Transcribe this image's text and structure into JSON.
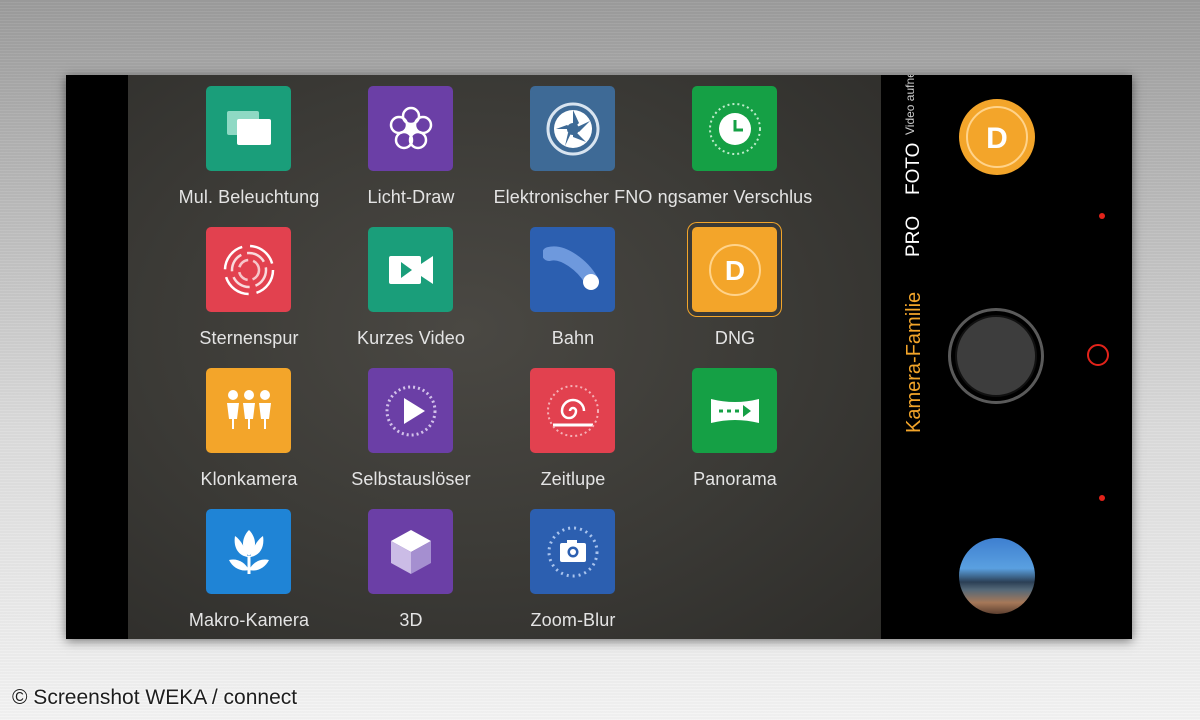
{
  "modes": [
    {
      "label": "Video aufnehmen",
      "state": "small"
    },
    {
      "label": "FOTO",
      "state": "normal"
    },
    {
      "label": "PRO",
      "state": "normal"
    },
    {
      "label": "Kamera-Familie",
      "state": "active"
    }
  ],
  "apps": [
    {
      "label": "Mul. Beleuchtung",
      "color": "#1a9e7a",
      "icon": "windows-icon"
    },
    {
      "label": "Licht-Draw",
      "color": "#6b3fa6",
      "icon": "flower-icon"
    },
    {
      "label": "Elektronischer FNO",
      "color": "#3e6a96",
      "icon": "aperture-icon"
    },
    {
      "label": "ngsamer Verschlus",
      "color": "#15a045",
      "icon": "clock-icon"
    },
    {
      "label": "Sternenspur",
      "color": "#e2414f",
      "icon": "star-trail-icon"
    },
    {
      "label": "Kurzes Video",
      "color": "#1a9e7a",
      "icon": "video-camera-icon"
    },
    {
      "label": "Bahn",
      "color": "#2c5fb0",
      "icon": "comet-icon"
    },
    {
      "label": "DNG",
      "color": "#f3a52a",
      "icon": "dng-icon"
    },
    {
      "label": "Klonkamera",
      "color": "#f3a52a",
      "icon": "people-icon"
    },
    {
      "label": "Selbstauslöser",
      "color": "#6b3fa6",
      "icon": "play-timer-icon"
    },
    {
      "label": "Zeitlupe",
      "color": "#e2414f",
      "icon": "snail-icon"
    },
    {
      "label": "Panorama",
      "color": "#15a045",
      "icon": "panorama-icon"
    },
    {
      "label": "Makro-Kamera",
      "color": "#1f84d6",
      "icon": "tulip-icon"
    },
    {
      "label": "3D",
      "color": "#6b3fa6",
      "icon": "cube-icon"
    },
    {
      "label": "Zoom-Blur",
      "color": "#2c5fb0",
      "icon": "camera-burst-icon"
    }
  ],
  "selected_app": "DNG",
  "badge": {
    "letter": "D",
    "color": "#f3a52a"
  },
  "copyright": "© Screenshot WEKA / connect"
}
